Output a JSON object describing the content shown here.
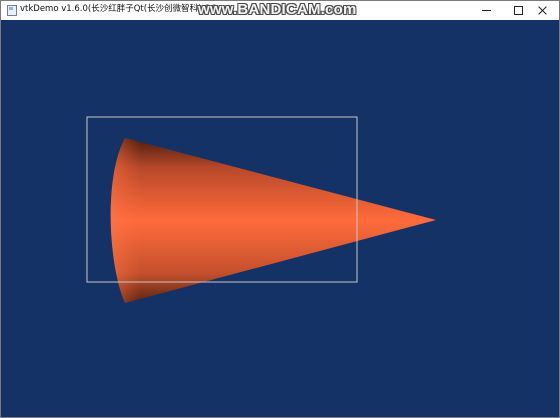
{
  "window": {
    "title": "vtkDemo v1.6.0(长沙红胖子Qt(长沙创微智科) QQ:",
    "watermark": "www.BANDICAM.com",
    "controls": [
      "minimize",
      "maximize",
      "close"
    ]
  },
  "viewport": {
    "background_color": "#153266",
    "actor": "cone",
    "actor_color": "#ff6b3b",
    "bounding_box_color": "#c8c8c8"
  }
}
